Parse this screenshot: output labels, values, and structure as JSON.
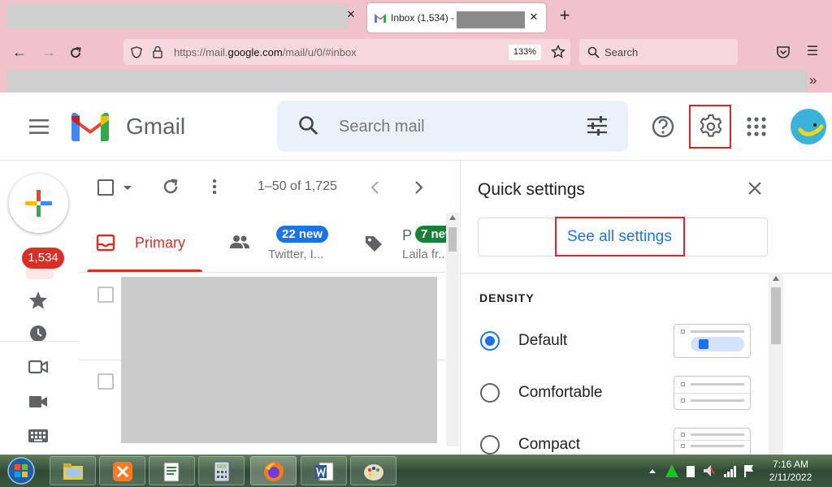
{
  "browser": {
    "active_tab_title": "Inbox (1,534) -",
    "url_host_prefix": "https://mail.",
    "url_host": "google.com",
    "url_path": "/mail/u/0/#inbox",
    "zoom": "133%",
    "search_placeholder": "Search"
  },
  "gmail": {
    "app_name": "Gmail",
    "search_placeholder": "Search mail",
    "inbox_badge": "1,534",
    "range_text": "1–50 of 1,725",
    "tabs": [
      {
        "label": "Primary",
        "color": "#d93025"
      },
      {
        "pill": "22 new",
        "sub": "Twitter, I...",
        "pill_color": "#1a73e8"
      },
      {
        "label": "P",
        "pill": "7 new",
        "sub": "Laila fr...",
        "pill_color": "#188038"
      }
    ]
  },
  "quick_settings": {
    "title": "Quick settings",
    "see_all_label": "See all settings",
    "density_heading": "DENSITY",
    "options": [
      {
        "label": "Default",
        "selected": true
      },
      {
        "label": "Comfortable",
        "selected": false
      },
      {
        "label": "Compact",
        "selected": false
      }
    ]
  },
  "taskbar": {
    "time": "7:16 AM",
    "date": "2/11/2022"
  },
  "colors": {
    "chrome_pink": "#f0c2cb",
    "highlight_red": "#d9262e",
    "gmail_red": "#d93025",
    "link_blue": "#1a73e8"
  }
}
